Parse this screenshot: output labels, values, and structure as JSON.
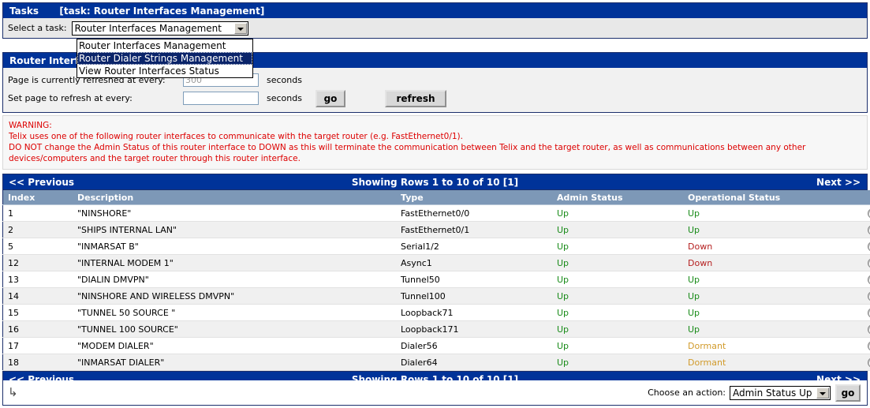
{
  "tasks_panel": {
    "bar_title": "Tasks",
    "bar_subtitle": "[task: Router Interfaces Management]",
    "select_label": "Select a task:",
    "task_select_value": "Router Interfaces Management",
    "dropdown_open": true,
    "dropdown_options": [
      "Router Interfaces Management",
      "Router Dialer Strings Management",
      "View Router Interfaces Status"
    ],
    "dropdown_highlighted_index": 1
  },
  "refresh_panel": {
    "bar_title": "Router Interfaces Management",
    "current_refresh_label": "Page is currently refreshed at every:",
    "current_refresh_value": "300",
    "set_refresh_label": "Set page to refresh at every:",
    "set_refresh_value": "",
    "seconds_unit": "seconds",
    "go_label": "go",
    "refresh_label": "refresh"
  },
  "warning": {
    "heading": "WARNING:",
    "line1": "Telix uses one of the following router interfaces to communicate with the target router (e.g. FastEthernet0/1).",
    "line2": "DO NOT change the Admin Status of this router interface to DOWN as this will terminate the communication between Telix and the target router, as well as communications between any other devices/computers and the target router through this router interface.",
    "color": "#dd0000"
  },
  "pager": {
    "previous_label": "<< Previous",
    "showing_label": "Showing Rows 1 to 10 of 10 [1]",
    "next_label": "Next >>"
  },
  "table": {
    "columns": [
      "Index",
      "Description",
      "Type",
      "Admin Status",
      "Operational Status",
      ""
    ],
    "rows": [
      {
        "index": "1",
        "description": "\"NINSHORE\"",
        "type": "FastEthernet0/0",
        "admin": "Up",
        "admin_state": "up",
        "oper": "Up",
        "oper_state": "up"
      },
      {
        "index": "2",
        "description": "\"SHIPS INTERNAL LAN\"",
        "type": "FastEthernet0/1",
        "admin": "Up",
        "admin_state": "up",
        "oper": "Up",
        "oper_state": "up"
      },
      {
        "index": "5",
        "description": "\"INMARSAT B\"",
        "type": "Serial1/2",
        "admin": "Up",
        "admin_state": "up",
        "oper": "Down",
        "oper_state": "down"
      },
      {
        "index": "12",
        "description": "\"INTERNAL MODEM 1\"",
        "type": "Async1",
        "admin": "Up",
        "admin_state": "up",
        "oper": "Down",
        "oper_state": "down"
      },
      {
        "index": "13",
        "description": "\"DIALIN DMVPN\"",
        "type": "Tunnel50",
        "admin": "Up",
        "admin_state": "up",
        "oper": "Up",
        "oper_state": "up"
      },
      {
        "index": "14",
        "description": "\"NINSHORE AND WIRELESS DMVPN\"",
        "type": "Tunnel100",
        "admin": "Up",
        "admin_state": "up",
        "oper": "Up",
        "oper_state": "up"
      },
      {
        "index": "15",
        "description": "\"TUNNEL 50 SOURCE \"",
        "type": "Loopback71",
        "admin": "Up",
        "admin_state": "up",
        "oper": "Up",
        "oper_state": "up"
      },
      {
        "index": "16",
        "description": "\"TUNNEL 100 SOURCE\"",
        "type": "Loopback171",
        "admin": "Up",
        "admin_state": "up",
        "oper": "Up",
        "oper_state": "up"
      },
      {
        "index": "17",
        "description": "\"MODEM DIALER\"",
        "type": "Dialer56",
        "admin": "Up",
        "admin_state": "up",
        "oper": "Dormant",
        "oper_state": "dormant"
      },
      {
        "index": "18",
        "description": "\"INMARSAT DIALER\"",
        "type": "Dialer64",
        "admin": "Up",
        "admin_state": "up",
        "oper": "Dormant",
        "oper_state": "dormant"
      }
    ]
  },
  "action_bar": {
    "enter_icon": "↳",
    "choose_label": "Choose an action:",
    "action_value": "Admin Status Up",
    "go_label": "go"
  },
  "colors": {
    "header_blue": "#003399",
    "table_header": "#7d98b7",
    "status_up": "#1a8c1a",
    "status_down": "#b52020",
    "status_dormant": "#d19a2a",
    "warning": "#dd0000"
  }
}
